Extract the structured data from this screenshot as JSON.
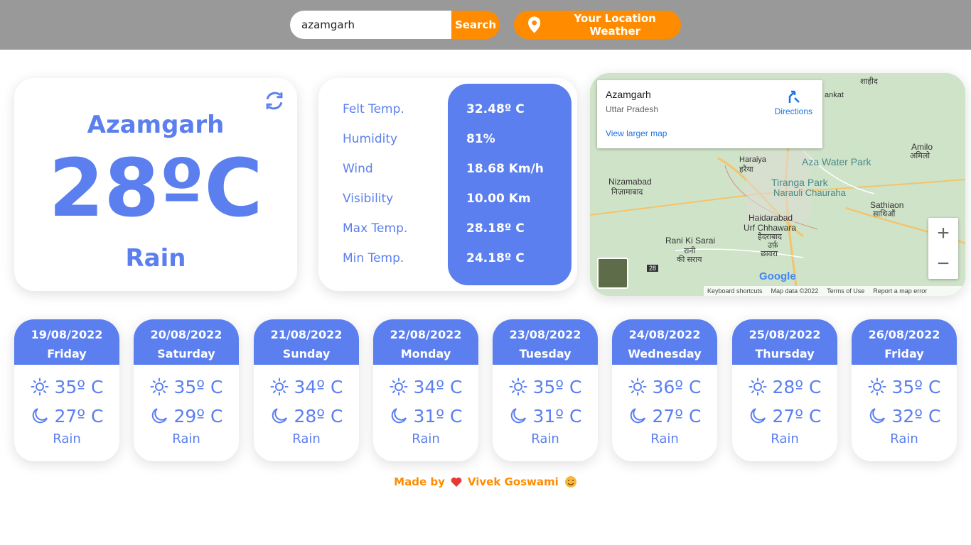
{
  "search": {
    "value": "azamgarh",
    "button_label": "Search"
  },
  "location_button": {
    "label": "Your Location Weather",
    "icon": "location-pin-icon"
  },
  "current": {
    "city": "Azamgarh",
    "temperature": "28ºC",
    "condition": "Rain",
    "refresh_icon": "refresh-icon"
  },
  "details": {
    "labels": [
      "Felt Temp.",
      "Humidity",
      "Wind",
      "Visibility",
      "Max Temp.",
      "Min Temp."
    ],
    "values": [
      "32.48º C",
      "81%",
      "18.68 Km/h",
      "10.00 Km",
      "28.18º C",
      "24.18º C"
    ]
  },
  "map": {
    "place": "Azamgarh",
    "region": "Uttar Pradesh",
    "larger_map": "View larger map",
    "directions": "Directions",
    "labels": {
      "haraiya": "Haraiya",
      "haraiya_hi": "हरैया",
      "water_park": "Aza Water Park",
      "tiranga": "Tiranga Park",
      "narauli": "Narauli Chauraha",
      "nizamabad": "Nizamabad",
      "nizamabad_hi": "निज़ामाबाद",
      "haidarabad": "Haidarabad",
      "urf": "Urf Chhawara",
      "haidarabad_hi1": "हैदराबाद",
      "haidarabad_hi2": "उर्फ़",
      "haidarabad_hi3": "छावरा",
      "rani": "Rani Ki Sarai",
      "rani_hi1": "रानी",
      "rani_hi2": "की सराय",
      "sathiaon": "Sathiaon",
      "sathiaon_hi": "साथिऔं",
      "amilo": "Amilo",
      "amilo_hi": "अमिलो",
      "shahid": "शाहीद",
      "ankat": "ankat",
      "road_28": "28",
      "google": "Google"
    },
    "zoom_in": "+",
    "zoom_out": "−",
    "footer": [
      "Keyboard shortcuts",
      "Map data ©2022",
      "Terms of Use",
      "Report a map error"
    ]
  },
  "forecast": [
    {
      "date": "19/08/2022",
      "day": "Friday",
      "max": "35º C",
      "min": "27º C",
      "cond": "Rain"
    },
    {
      "date": "20/08/2022",
      "day": "Saturday",
      "max": "35º C",
      "min": "29º C",
      "cond": "Rain"
    },
    {
      "date": "21/08/2022",
      "day": "Sunday",
      "max": "34º C",
      "min": "28º C",
      "cond": "Rain"
    },
    {
      "date": "22/08/2022",
      "day": "Monday",
      "max": "34º C",
      "min": "31º C",
      "cond": "Rain"
    },
    {
      "date": "23/08/2022",
      "day": "Tuesday",
      "max": "35º C",
      "min": "31º C",
      "cond": "Rain"
    },
    {
      "date": "24/08/2022",
      "day": "Wednesday",
      "max": "36º C",
      "min": "27º C",
      "cond": "Rain"
    },
    {
      "date": "25/08/2022",
      "day": "Thursday",
      "max": "28º C",
      "min": "27º C",
      "cond": "Rain"
    },
    {
      "date": "26/08/2022",
      "day": "Friday",
      "max": "35º C",
      "min": "32º C",
      "cond": "Rain"
    }
  ],
  "footer": {
    "made_by": "Made by",
    "author": "Vivek Goswami",
    "heart_icon": "heart-icon",
    "emoji_icon": "smiling-face-icon"
  },
  "colors": {
    "accent": "#5b7fef",
    "orange": "#ff8c00",
    "topbar": "#999999"
  }
}
